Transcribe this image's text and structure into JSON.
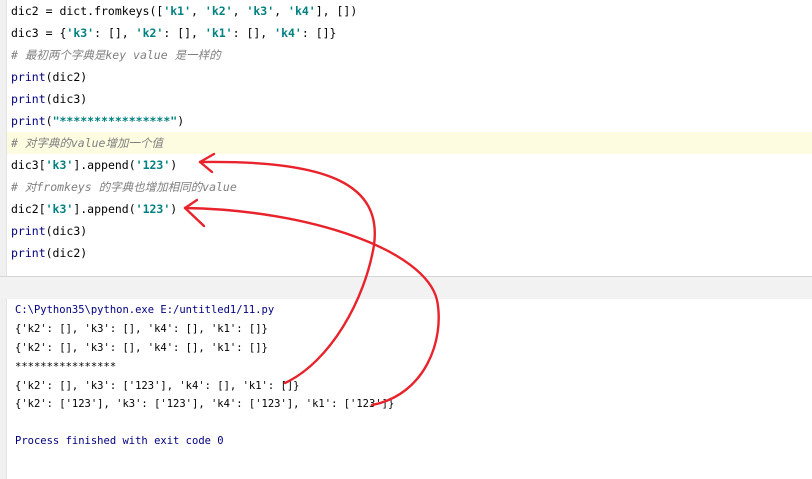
{
  "editor": {
    "lines": [
      {
        "parts": [
          {
            "t": "dic2 = dict.fromkeys([",
            "c": ""
          },
          {
            "t": "'k1'",
            "c": "s"
          },
          {
            "t": ", ",
            "c": ""
          },
          {
            "t": "'k2'",
            "c": "s"
          },
          {
            "t": ", ",
            "c": ""
          },
          {
            "t": "'k3'",
            "c": "s"
          },
          {
            "t": ", ",
            "c": ""
          },
          {
            "t": "'k4'",
            "c": "s"
          },
          {
            "t": "], [])",
            "c": ""
          }
        ]
      },
      {
        "parts": [
          {
            "t": "dic3 = {",
            "c": ""
          },
          {
            "t": "'k3'",
            "c": "s"
          },
          {
            "t": ": [], ",
            "c": ""
          },
          {
            "t": "'k2'",
            "c": "s"
          },
          {
            "t": ": [], ",
            "c": ""
          },
          {
            "t": "'k1'",
            "c": "s"
          },
          {
            "t": ": [], ",
            "c": ""
          },
          {
            "t": "'k4'",
            "c": "s"
          },
          {
            "t": ": []}",
            "c": ""
          }
        ]
      },
      {
        "parts": [
          {
            "t": "# 最初两个字典是key value 是一样的",
            "c": "cm"
          }
        ]
      },
      {
        "parts": [
          {
            "t": "print",
            "c": "kw"
          },
          {
            "t": "(dic2)",
            "c": ""
          }
        ]
      },
      {
        "parts": [
          {
            "t": "print",
            "c": "kw"
          },
          {
            "t": "(dic3)",
            "c": ""
          }
        ]
      },
      {
        "parts": [
          {
            "t": "print",
            "c": "kw"
          },
          {
            "t": "(",
            "c": ""
          },
          {
            "t": "\"****************\"",
            "c": "s"
          },
          {
            "t": ")",
            "c": ""
          }
        ]
      },
      {
        "parts": [
          {
            "t": "# 对字典的value增加一个值",
            "c": "cm"
          }
        ]
      },
      {
        "parts": [
          {
            "t": "dic3[",
            "c": ""
          },
          {
            "t": "'k3'",
            "c": "s"
          },
          {
            "t": "].append(",
            "c": ""
          },
          {
            "t": "'123'",
            "c": "s"
          },
          {
            "t": ")",
            "c": ""
          }
        ]
      },
      {
        "parts": [
          {
            "t": "# 对fromkeys 的字典也增加相同的value",
            "c": "cm"
          }
        ]
      },
      {
        "parts": [
          {
            "t": "dic2[",
            "c": ""
          },
          {
            "t": "'k3'",
            "c": "s"
          },
          {
            "t": "].append(",
            "c": ""
          },
          {
            "t": "'123'",
            "c": "s"
          },
          {
            "t": ")",
            "c": ""
          }
        ]
      },
      {
        "parts": [
          {
            "t": "print",
            "c": "kw"
          },
          {
            "t": "(dic3)",
            "c": ""
          }
        ]
      },
      {
        "parts": [
          {
            "t": "print",
            "c": "kw"
          },
          {
            "t": "(dic2)",
            "c": ""
          }
        ]
      }
    ]
  },
  "console": {
    "command": "C:\\Python35\\python.exe E:/untitled1/11.py",
    "out1": "{'k2': [], 'k3': [], 'k4': [], 'k1': []}",
    "out2": "{'k2': [], 'k3': [], 'k4': [], 'k1': []}",
    "out3": "****************",
    "out4": "{'k2': [], 'k3': ['123'], 'k4': [], 'k1': []}",
    "out5": "{'k2': ['123'], 'k3': ['123'], 'k4': ['123'], 'k1': ['123']}",
    "exit": "Process finished with exit code 0"
  },
  "colors": {
    "annotation": "#e8232b",
    "string": "#008080",
    "keyword": "#000080",
    "comment": "#808080"
  }
}
